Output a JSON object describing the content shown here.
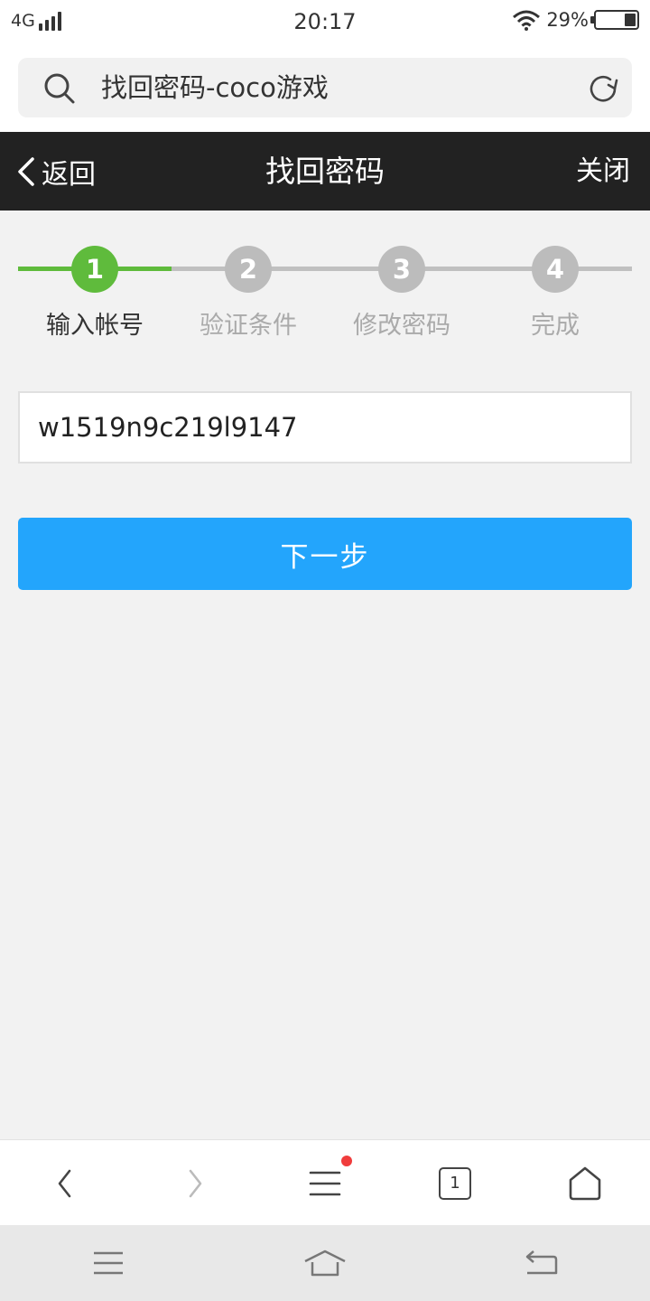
{
  "status_bar": {
    "network": "4G",
    "time": "20:17",
    "battery_percent": "29%",
    "battery_level": 0.29
  },
  "address_bar": {
    "url_title": "找回密码-coco游戏"
  },
  "header": {
    "back_label": "返回",
    "title": "找回密码",
    "close_label": "关闭"
  },
  "stepper": {
    "current_step": 1,
    "steps": [
      {
        "number": "1",
        "label": "输入帐号"
      },
      {
        "number": "2",
        "label": "验证条件"
      },
      {
        "number": "3",
        "label": "修改密码"
      },
      {
        "number": "4",
        "label": "完成"
      }
    ]
  },
  "form": {
    "account_value": "w1519n9c219l9147",
    "next_label": "下一步"
  },
  "browser_toolbar": {
    "tab_count": "1"
  },
  "colors": {
    "header_bg": "#222222",
    "step_active": "#5fbb3c",
    "step_inactive": "#bcbcbc",
    "primary_button": "#23a5fc",
    "notification_dot": "#f03c3c"
  }
}
